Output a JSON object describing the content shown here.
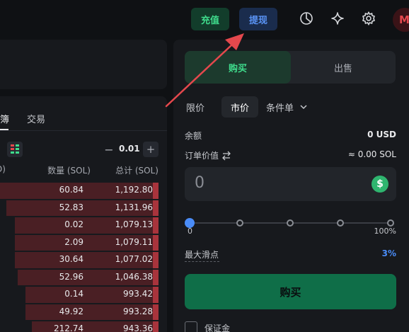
{
  "topbar": {
    "deposit_label": "充值",
    "withdraw_label": "提现",
    "icons": [
      "pie-chart-icon",
      "sparkle-icon",
      "gear-icon"
    ],
    "avatar_initial": "M"
  },
  "orderbook": {
    "tabs": [
      "簿",
      "交易"
    ],
    "step_value": "0.01",
    "minus": "−",
    "plus": "+",
    "headers": {
      "price_partial": "D)",
      "quantity": "数量 (SOL)",
      "total": "总计 (SOL)"
    },
    "rows": [
      {
        "qty": "60.84",
        "total": "1,192.80",
        "depth": 1.0
      },
      {
        "qty": "52.83",
        "total": "1,131.96",
        "depth": 0.95
      },
      {
        "qty": "0.02",
        "total": "1,079.13",
        "depth": 0.9
      },
      {
        "qty": "2.09",
        "total": "1,079.11",
        "depth": 0.9
      },
      {
        "qty": "30.64",
        "total": "1,077.02",
        "depth": 0.9
      },
      {
        "qty": "52.96",
        "total": "1,046.38",
        "depth": 0.88
      },
      {
        "qty": "0.14",
        "total": "993.42",
        "depth": 0.83
      },
      {
        "qty": "49.92",
        "total": "993.28",
        "depth": 0.83
      },
      {
        "qty": "212.74",
        "total": "943.36",
        "depth": 0.79
      }
    ]
  },
  "trade": {
    "side_tabs": {
      "buy": "购买",
      "sell": "出售"
    },
    "order_types": {
      "limit": "限价",
      "market": "市价",
      "conditional": "条件单"
    },
    "balance_label": "余额",
    "balance_value": "0 USD",
    "order_value_label": "订单价值",
    "order_value_conv": "≈ 0.00 SOL",
    "amount_value": "0",
    "currency_symbol": "$",
    "slider": {
      "min_label": "0",
      "max_label": "100%",
      "value": 0
    },
    "slippage_label": "最大滑点",
    "slippage_value": "3%",
    "buy_button": "购买",
    "margin_label": "保证金"
  },
  "colors": {
    "accent_green": "#3fdc8c",
    "accent_blue": "#4a8cf7",
    "ask_red": "#a8343c",
    "annotation_arrow": "#e5484d"
  }
}
